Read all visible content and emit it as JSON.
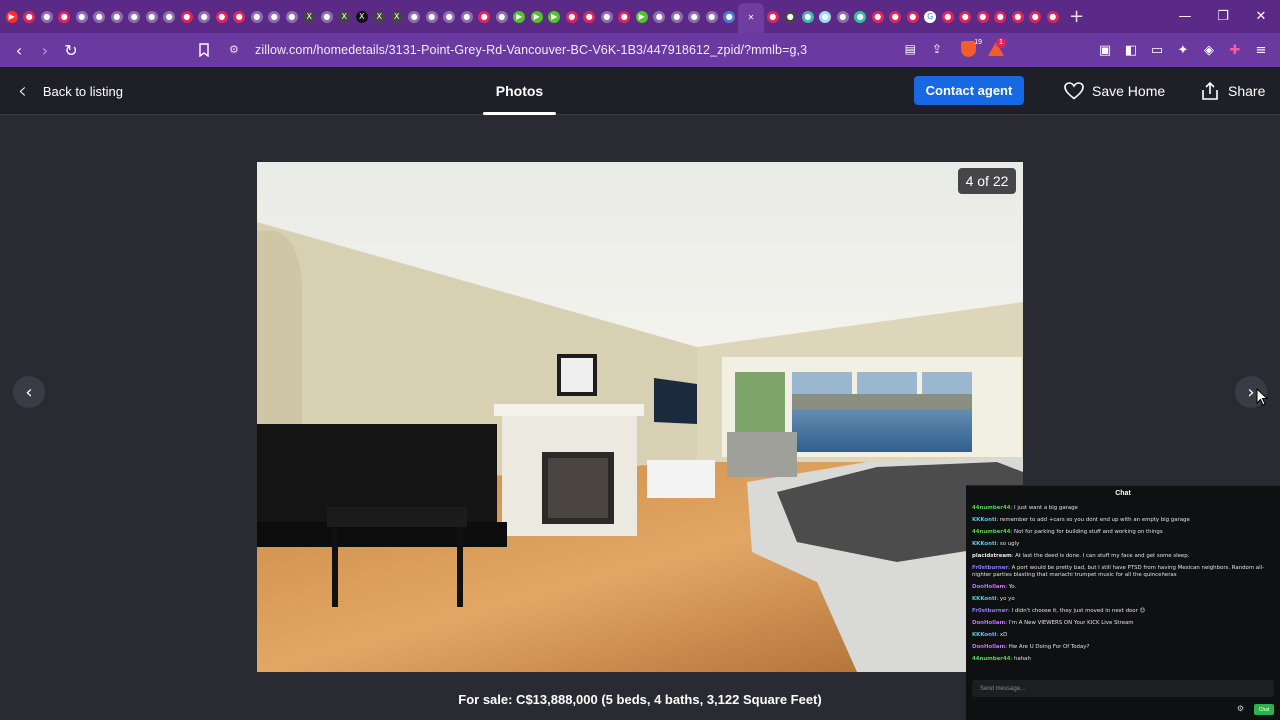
{
  "browser": {
    "tab_icons": [
      {
        "icon": "youtube-icon",
        "color": "#ff2d2d",
        "glyph": "▶"
      },
      {
        "icon": "site-icon",
        "color": "#e0245e",
        "glyph": "●"
      },
      {
        "icon": "site-icon",
        "color": "#8d6db0",
        "glyph": "●"
      },
      {
        "icon": "site-icon",
        "color": "#e0245e",
        "glyph": "●"
      },
      {
        "icon": "site-icon",
        "color": "#8d6db0",
        "glyph": "●"
      },
      {
        "icon": "site-icon",
        "color": "#8d6db0",
        "glyph": "●"
      },
      {
        "icon": "site-icon",
        "color": "#8d6db0",
        "glyph": "●"
      },
      {
        "icon": "site-icon",
        "color": "#8d6db0",
        "glyph": "●"
      },
      {
        "icon": "site-icon",
        "color": "#8d6db0",
        "glyph": "●"
      },
      {
        "icon": "site-icon",
        "color": "#8d6db0",
        "glyph": "●"
      },
      {
        "icon": "site-icon",
        "color": "#e0245e",
        "glyph": "●"
      },
      {
        "icon": "site-icon",
        "color": "#8d6db0",
        "glyph": "●"
      },
      {
        "icon": "site-icon",
        "color": "#e0245e",
        "glyph": "●"
      },
      {
        "icon": "site-icon",
        "color": "#e0245e",
        "glyph": "●"
      },
      {
        "icon": "site-icon",
        "color": "#8d6db0",
        "glyph": "●"
      },
      {
        "icon": "site-icon",
        "color": "#8d6db0",
        "glyph": "●"
      },
      {
        "icon": "site-icon",
        "color": "#8d6db0",
        "glyph": "●"
      },
      {
        "icon": "x-icon",
        "color": "#444",
        "glyph": "X"
      },
      {
        "icon": "site-icon",
        "color": "#8d6db0",
        "glyph": "●"
      },
      {
        "icon": "x-icon",
        "color": "#444",
        "glyph": "X"
      },
      {
        "icon": "x-icon",
        "color": "#111",
        "glyph": "X"
      },
      {
        "icon": "x-icon",
        "color": "#444",
        "glyph": "X"
      },
      {
        "icon": "x-icon",
        "color": "#444",
        "glyph": "X"
      },
      {
        "icon": "site-icon",
        "color": "#8d6db0",
        "glyph": "●"
      },
      {
        "icon": "site-icon",
        "color": "#8d6db0",
        "glyph": "●"
      },
      {
        "icon": "site-icon",
        "color": "#8d6db0",
        "glyph": "●"
      },
      {
        "icon": "site-icon",
        "color": "#8d6db0",
        "glyph": "●"
      },
      {
        "icon": "site-icon",
        "color": "#e0245e",
        "glyph": "●"
      },
      {
        "icon": "site-icon",
        "color": "#8d6db0",
        "glyph": "●"
      },
      {
        "icon": "play-icon",
        "color": "#53c22b",
        "glyph": "▶"
      },
      {
        "icon": "play-icon",
        "color": "#53c22b",
        "glyph": "▶"
      },
      {
        "icon": "play-icon",
        "color": "#53c22b",
        "glyph": "▶"
      },
      {
        "icon": "site-icon",
        "color": "#e0245e",
        "glyph": "●"
      },
      {
        "icon": "site-icon",
        "color": "#e0245e",
        "glyph": "●"
      },
      {
        "icon": "site-icon",
        "color": "#8d6db0",
        "glyph": "●"
      },
      {
        "icon": "site-icon",
        "color": "#e0245e",
        "glyph": "●"
      },
      {
        "icon": "play-icon",
        "color": "#53c22b",
        "glyph": "▶"
      },
      {
        "icon": "site-icon",
        "color": "#8d6db0",
        "glyph": "●"
      },
      {
        "icon": "site-icon",
        "color": "#8d6db0",
        "glyph": "●"
      },
      {
        "icon": "site-icon",
        "color": "#8d6db0",
        "glyph": "●"
      },
      {
        "icon": "site-icon",
        "color": "#8d6db0",
        "glyph": "●"
      },
      {
        "icon": "site-icon",
        "color": "#4a7ccf",
        "glyph": "●"
      },
      {
        "icon": "zillow-icon",
        "color": "#6f3da0",
        "glyph": "✕",
        "active": true
      },
      {
        "icon": "site-icon",
        "color": "#e0245e",
        "glyph": "●"
      },
      {
        "icon": "site-icon",
        "color": "#444",
        "glyph": "●"
      },
      {
        "icon": "site-icon",
        "color": "#3fb8af",
        "glyph": "●"
      },
      {
        "icon": "site-icon",
        "color": "#9fd8ef",
        "glyph": "●"
      },
      {
        "icon": "site-icon",
        "color": "#8d6db0",
        "glyph": "●"
      },
      {
        "icon": "site-icon",
        "color": "#35c29b",
        "glyph": "●"
      },
      {
        "icon": "site-icon",
        "color": "#e0245e",
        "glyph": "●"
      },
      {
        "icon": "site-icon",
        "color": "#e0245e",
        "glyph": "●"
      },
      {
        "icon": "site-icon",
        "color": "#e0245e",
        "glyph": "●"
      },
      {
        "icon": "google-icon",
        "color": "#ffffff",
        "glyph": "G"
      },
      {
        "icon": "site-icon",
        "color": "#e0245e",
        "glyph": "●"
      },
      {
        "icon": "site-icon",
        "color": "#e0245e",
        "glyph": "●"
      },
      {
        "icon": "site-icon",
        "color": "#e0245e",
        "glyph": "●"
      },
      {
        "icon": "site-icon",
        "color": "#e0245e",
        "glyph": "●"
      },
      {
        "icon": "site-icon",
        "color": "#e0245e",
        "glyph": "●"
      },
      {
        "icon": "site-icon",
        "color": "#e0245e",
        "glyph": "●"
      },
      {
        "icon": "site-icon",
        "color": "#e0245e",
        "glyph": "●"
      }
    ],
    "new_tab_glyph": "+",
    "url": "zillow.com/homedetails/3131-Point-Grey-Rd-Vancouver-BC-V6K-1B3/447918612_zpid/?mmlb=g,3",
    "brave_badge": "19",
    "alert_badge": "1"
  },
  "header": {
    "back_label": "Back to listing",
    "photos_tab": "Photos",
    "contact_label": "Contact agent",
    "save_label": "Save Home",
    "share_label": "Share"
  },
  "gallery": {
    "counter": "4 of 22",
    "caption": "For sale: C$13,888,000 (5 beds, 4 baths, 3,122 Square Feet)"
  },
  "chat": {
    "title": "Chat",
    "messages": [
      {
        "user": "44number44",
        "color": "#52d352",
        "text": ": I just want a big garage"
      },
      {
        "user": "KKKonti",
        "color": "#59c9f0",
        "text": ": remember to add +cars so you dont end up with an empty big garage"
      },
      {
        "user": "44number44",
        "color": "#52d352",
        "text": ": Not for parking for building stuff and working on things"
      },
      {
        "user": "KKKonti",
        "color": "#59c9f0",
        "text": ": so ugly"
      },
      {
        "user": "placidstream",
        "color": "#e8e8e8",
        "text": ": At last the deed is done. I can stuff my face and get some sleep."
      },
      {
        "user": "Fr0stburner",
        "color": "#8a7bff",
        "text": ": A port would be pretty bad, but I still have PTSD from having Mexican neighbors. Random all-nighter parties blasting that mariachi trumpet music for all the quinceñeras"
      },
      {
        "user": "DonHollam",
        "color": "#c96cff",
        "text": ": Yo."
      },
      {
        "user": "KKKonti",
        "color": "#59c9f0",
        "text": ": yo yo"
      },
      {
        "user": "Fr0stburner",
        "color": "#8a7bff",
        "text": ": I didn't choose it, they just moved in next door 😊"
      },
      {
        "user": "DonHollam",
        "color": "#c96cff",
        "text": ": I'm A New VIEWERS ON Your KICK Live Stream"
      },
      {
        "user": "KKKonti",
        "color": "#59c9f0",
        "text": ": xD"
      },
      {
        "user": "DonHollam",
        "color": "#c96cff",
        "text": ": Hw Are U Doing For Of Today?"
      },
      {
        "user": "44number44",
        "color": "#52d352",
        "text": ": hahah"
      }
    ],
    "input_placeholder": "Send message...",
    "send_label": "Chat"
  }
}
